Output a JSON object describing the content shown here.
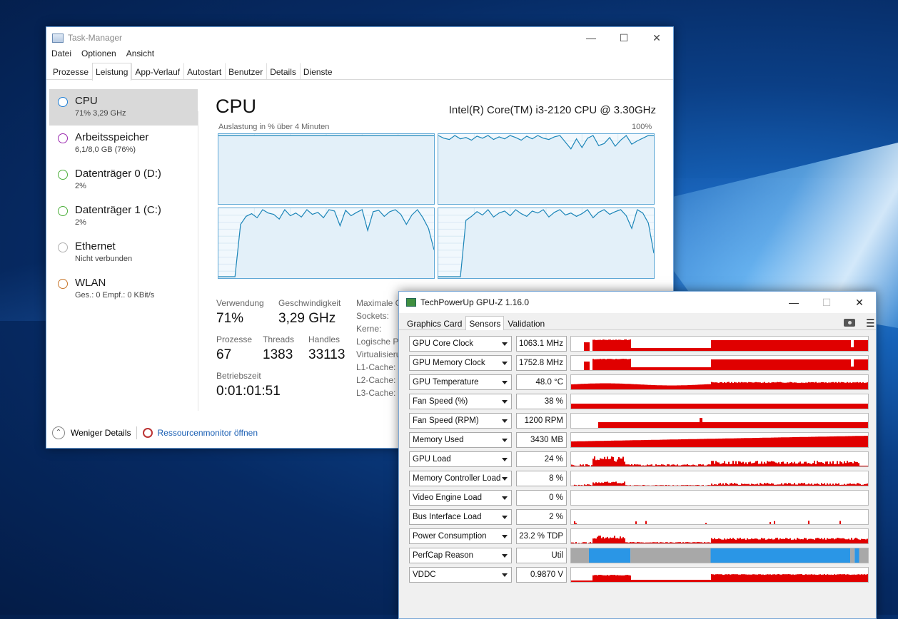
{
  "task_manager": {
    "title": "Task-Manager",
    "menu": [
      "Datei",
      "Optionen",
      "Ansicht"
    ],
    "tabs": [
      "Prozesse",
      "Leistung",
      "App-Verlauf",
      "Autostart",
      "Benutzer",
      "Details",
      "Dienste"
    ],
    "active_tab": "Leistung",
    "sidebar": [
      {
        "name": "CPU",
        "sub": "71% 3,29 GHz",
        "color": "#1c7ed6"
      },
      {
        "name": "Arbeitsspeicher",
        "sub": "6,1/8,0 GB (76%)",
        "color": "#9c2bb0"
      },
      {
        "name": "Datenträger 0 (D:)",
        "sub": "2%",
        "color": "#4caf3a"
      },
      {
        "name": "Datenträger 1 (C:)",
        "sub": "2%",
        "color": "#4caf3a"
      },
      {
        "name": "Ethernet",
        "sub": "Nicht verbunden",
        "color": "#b0b0b0"
      },
      {
        "name": "WLAN",
        "sub": "Ges.: 0 Empf.: 0 KBit/s",
        "color": "#c8762a"
      }
    ],
    "cpu": {
      "heading": "CPU",
      "model": "Intel(R) Core(TM) i3-2120 CPU @ 3.30GHz",
      "graph_caption": "Auslastung in % über 4 Minuten",
      "graph_max": "100%",
      "graph_color": "#1b85b8",
      "cores": [
        [
          100,
          100,
          100,
          100,
          100,
          100,
          100,
          100,
          100,
          100,
          100,
          100,
          100,
          100,
          100,
          100,
          100,
          100,
          100,
          100,
          100,
          100,
          100,
          100,
          100,
          100,
          100,
          100,
          100,
          100,
          100,
          100,
          100,
          100,
          100,
          100,
          100,
          100,
          100,
          100
        ],
        [
          100,
          96,
          94,
          100,
          95,
          97,
          93,
          99,
          96,
          100,
          94,
          98,
          95,
          100,
          97,
          93,
          99,
          95,
          100,
          96,
          94,
          98,
          100,
          90,
          80,
          95,
          82,
          96,
          100,
          85,
          88,
          97,
          84,
          93,
          100,
          87,
          92,
          96,
          100,
          100
        ],
        [
          0,
          0,
          0,
          0,
          78,
          90,
          94,
          88,
          100,
          95,
          93,
          86,
          100,
          91,
          95,
          89,
          100,
          93,
          96,
          88,
          100,
          98,
          76,
          99,
          91,
          96,
          100,
          69,
          97,
          99,
          90,
          97,
          100,
          93,
          78,
          92,
          100,
          88,
          72,
          40
        ],
        [
          0,
          0,
          0,
          0,
          0,
          84,
          90,
          97,
          92,
          100,
          89,
          95,
          98,
          91,
          100,
          94,
          90,
          98,
          95,
          100,
          89,
          96,
          100,
          92,
          95,
          90,
          94,
          100,
          88,
          96,
          100,
          93,
          97,
          100,
          91,
          72,
          100,
          95,
          80,
          35
        ]
      ]
    },
    "stats": {
      "verwendung_label": "Verwendung",
      "verwendung": "71%",
      "geschwindigkeit_label": "Geschwindigkeit",
      "geschwindigkeit": "3,29 GHz",
      "prozesse_label": "Prozesse",
      "prozesse": "67",
      "threads_label": "Threads",
      "threads": "1383",
      "handles_label": "Handles",
      "handles": "33113",
      "betriebszeit_label": "Betriebszeit",
      "betriebszeit": "0:01:01:51"
    },
    "right_labels": [
      "Maximale G",
      "Sockets:",
      "Kerne:",
      "Logische Pr",
      "Virtualisieru",
      "L1-Cache:",
      "L2-Cache:",
      "L3-Cache:"
    ],
    "bottom": {
      "less_details": "Weniger Details",
      "resmon": "Ressourcenmonitor öffnen"
    }
  },
  "gpuz": {
    "title": "TechPowerUp GPU-Z 1.16.0",
    "tabs": [
      "Graphics Card",
      "Sensors",
      "Validation"
    ],
    "active_tab": "Sensors",
    "icons": [
      "camera-icon",
      "menu-icon"
    ],
    "graph_color": "#e00000",
    "perfcap_colors": {
      "util": "#2a96e6",
      "idle": "#a8a8a8"
    },
    "sensors": [
      {
        "name": "GPU Core Clock",
        "value": "1063.1 MHz",
        "shape": "clock"
      },
      {
        "name": "GPU Memory Clock",
        "value": "1752.8 MHz",
        "shape": "clock"
      },
      {
        "name": "GPU Temperature",
        "value": "48.0 °C",
        "shape": "temp"
      },
      {
        "name": "Fan Speed (%)",
        "value": "38 %",
        "shape": "fanpct"
      },
      {
        "name": "Fan Speed (RPM)",
        "value": "1200 RPM",
        "shape": "fanrpm"
      },
      {
        "name": "Memory Used",
        "value": "3430 MB",
        "shape": "mem"
      },
      {
        "name": "GPU Load",
        "value": "24 %",
        "shape": "load"
      },
      {
        "name": "Memory Controller Load",
        "value": "8 %",
        "shape": "mcload"
      },
      {
        "name": "Video Engine Load",
        "value": "0 %",
        "shape": "none"
      },
      {
        "name": "Bus Interface Load",
        "value": "2 %",
        "shape": "bus"
      },
      {
        "name": "Power Consumption",
        "value": "23.2 % TDP",
        "shape": "power"
      },
      {
        "name": "PerfCap Reason",
        "value": "Util",
        "shape": "perfcap"
      },
      {
        "name": "VDDC",
        "value": "0.9870 V",
        "shape": "vddc"
      }
    ]
  }
}
